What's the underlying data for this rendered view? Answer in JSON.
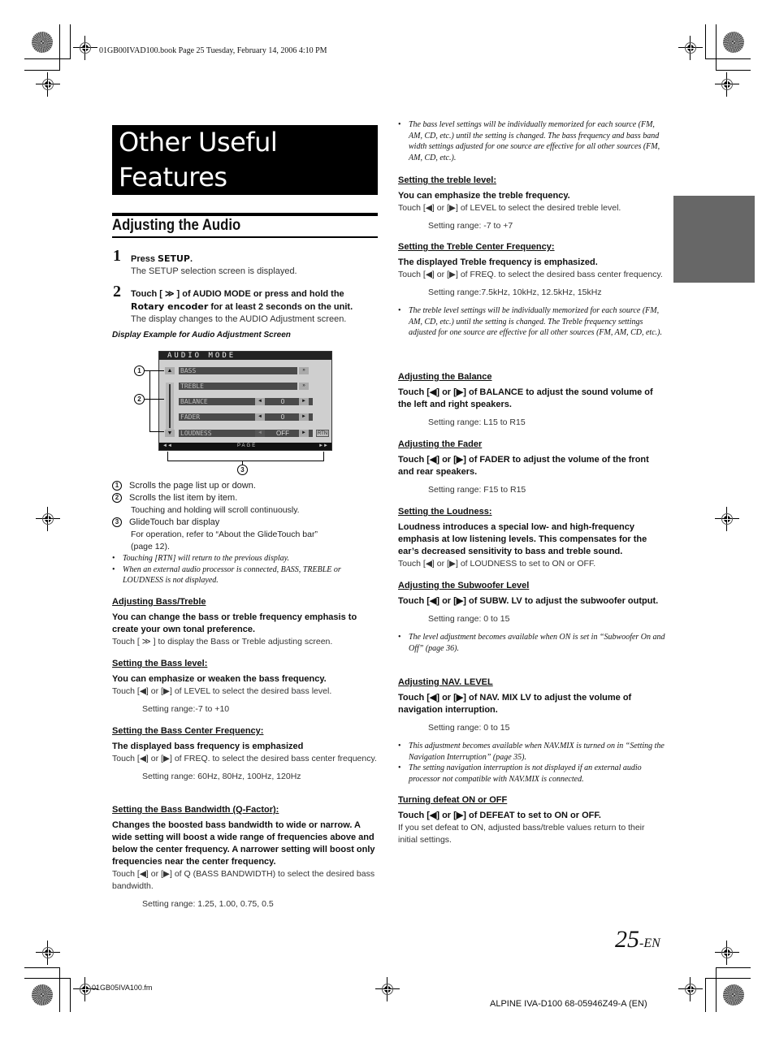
{
  "print_marks": {
    "book_header": "01GB00IVAD100.book  Page 25  Tuesday, February 14, 2006  4:10 PM",
    "fm_footer": "01GB05IVA100.fm",
    "model_footer": "ALPINE IVA-D100 68-05946Z49-A (EN)"
  },
  "page_number": {
    "number": "25",
    "suffix": "-EN"
  },
  "chapter_title": {
    "line1": "Other Useful",
    "line2": "Features"
  },
  "section_heading": "Adjusting the Audio",
  "steps": [
    {
      "num": "1",
      "text_pre": "Press ",
      "text_key": "SETUP",
      "text_post": ".",
      "sub": "The SETUP selection screen is displayed."
    },
    {
      "num": "2",
      "line1": "Touch [ ≫ ] of AUDIO MODE or press and hold the",
      "line2_key": "Rotary encoder",
      "line2_post": " for at least 2 seconds on the unit.",
      "sub": "The display changes to the AUDIO Adjustment screen."
    }
  ],
  "display_caption": "Display Example for Audio Adjustment Screen",
  "audio_screen": {
    "title": "AUDIO MODE",
    "rows": [
      {
        "label": "BASS",
        "control": "»"
      },
      {
        "label": "TREBLE",
        "control": "»"
      },
      {
        "label": "BALANCE",
        "value": "0"
      },
      {
        "label": "FADER",
        "value": "0"
      },
      {
        "label": "LOUDNESS",
        "value": "OFF"
      }
    ],
    "rtn_label": "RTN",
    "page_label": "PAGE",
    "left_arrows": "◄◄",
    "right_arrows": "►►",
    "scroll_up": "▲",
    "scroll_down": "▼",
    "left_btn": "◄",
    "right_btn": "►",
    "callouts": [
      "1",
      "2",
      "3"
    ]
  },
  "legend": [
    {
      "num": "1",
      "text": "Scrolls the page list up or down."
    },
    {
      "num": "2",
      "text": "Scrolls the list item by item.",
      "sub": "Touching and holding will scroll continuously."
    },
    {
      "num": "3",
      "text": "GlideTouch bar display",
      "sub": "For operation, refer to “About the GlideTouch bar”",
      "sub2": "(page 12)."
    }
  ],
  "left_notes": [
    "Touching [RTN] will return to the previous display.",
    "When an external audio processor is connected, BASS, TREBLE or LOUDNESS is not displayed."
  ],
  "left_sections": [
    {
      "heading": "Adjusting Bass/Treble",
      "lead": "You can change the bass or treble frequency emphasis to create your own tonal preference.",
      "body": "Touch [ ≫ ] to display the Bass or Treble adjusting screen."
    },
    {
      "heading": "Setting the Bass level:",
      "lead": "You can emphasize or weaken the bass frequency.",
      "body": "Touch [◀] or [▶] of LEVEL to select the desired bass level.",
      "range": "Setting range:-7 to +10"
    },
    {
      "heading": "Setting the Bass Center Frequency:",
      "lead": "The displayed bass frequency is emphasized",
      "body": "Touch [◀] or [▶] of FREQ. to select the desired bass center frequency.",
      "range": "Setting range: 60Hz, 80Hz, 100Hz, 120Hz"
    },
    {
      "heading": "Setting the Bass Bandwidth (Q-Factor):",
      "lead": "Changes the boosted bass bandwidth to wide or narrow. A wide setting will boost a wide range of frequencies above and below the center frequency. A narrower setting will boost only frequencies near the center frequency.",
      "body": "Touch [◀] or [▶] of Q (BASS BANDWIDTH) to select the desired bass bandwidth.",
      "range": "Setting range: 1.25, 1.00, 0.75, 0.5"
    }
  ],
  "right_sections": [
    {
      "note": "The bass level settings will be individually memorized for each source (FM, AM, CD, etc.) until the setting is changed. The bass frequency and bass band width settings adjusted for one source are effective for all other sources (FM, AM, CD, etc.)."
    },
    {
      "heading": "Setting the treble level:",
      "lead": "You can emphasize the treble frequency.",
      "body": "Touch [◀] or [▶] of LEVEL to select the desired treble level.",
      "range": "Setting range: -7 to +7"
    },
    {
      "heading": "Setting the Treble Center Frequency:",
      "lead": "The displayed Treble frequency is emphasized.",
      "body": "Touch [◀] or [▶] of FREQ. to select the desired bass center frequency.",
      "range": "Setting range:7.5kHz, 10kHz, 12.5kHz, 15kHz",
      "note": "The treble level settings will be individually memorized for each source (FM, AM, CD, etc.) until the setting is changed. The Treble frequency settings adjusted for one source are effective for all other sources (FM, AM, CD, etc.)."
    },
    {
      "heading": "Adjusting the Balance",
      "lead": "Touch [◀] or [▶] of BALANCE to adjust the sound volume of the left and right speakers.",
      "range": "Setting range: L15 to R15"
    },
    {
      "heading": "Adjusting the Fader",
      "lead": "Touch [◀] or [▶] of FADER to adjust the volume of the front and rear speakers.",
      "range": "Setting range: F15 to R15"
    },
    {
      "heading": "Setting the Loudness:",
      "lead": "Loudness introduces a special low- and high-frequency emphasis at low listening levels. This compensates for the ear’s decreased sensitivity to bass and treble sound.",
      "body": "Touch [◀] or [▶] of LOUDNESS to set to ON or OFF."
    },
    {
      "heading": "Adjusting the Subwoofer Level",
      "lead": "Touch [◀] or [▶] of SUBW. LV to adjust the subwoofer output.",
      "range": "Setting range: 0 to 15",
      "note": "The level adjustment becomes available when ON is set in “Subwoofer On and Off” (page 36)."
    },
    {
      "heading": "Adjusting NAV. LEVEL",
      "lead": "Touch [◀] or [▶] of NAV. MIX LV to adjust the volume of navigation interruption.",
      "range": "Setting range: 0 to 15",
      "note": "This adjustment becomes available when NAV.MIX is turned on in “Setting the Navigation Interruption” (page 35).",
      "note2": "The setting navigation interruption is not displayed if an external audio processor not compatible with NAV.MIX is connected."
    },
    {
      "heading": "Turning defeat ON or OFF",
      "lead": "Touch [◀] or [▶] of DEFEAT to set to ON or OFF.",
      "body": "If you set defeat to ON, adjusted bass/treble values return to their initial settings."
    }
  ]
}
